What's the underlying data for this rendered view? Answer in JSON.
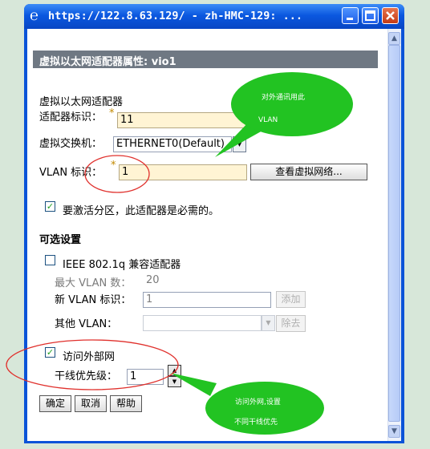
{
  "window": {
    "title": "https://122.8.63.129/ - zh-HMC-129: ...",
    "title_icon": "ie-icon",
    "controls": [
      "minimize-icon",
      "maximize-icon",
      "close-icon"
    ]
  },
  "panel": {
    "title": "虚拟以太网适配器属性: vio1"
  },
  "form": {
    "section_label": "虚拟以太网适配器",
    "adapter_id_label": "适配器标识：",
    "adapter_id_value": "11",
    "required_mark": "*",
    "vswitch_label": "虚拟交换机：",
    "vswitch_value": "ETHERNET0(Default)",
    "vlan_label": "VLAN 标识：",
    "vlan_value": "1",
    "view_networks_button": "查看虚拟网络...",
    "activate_checkbox_label": "要激活分区，此适配器是必需的。",
    "activate_checked": true
  },
  "optional": {
    "heading": "可选设置",
    "ieee_label": "IEEE 802.1q 兼容适配器",
    "ieee_checked": false,
    "max_vlan_label": "最大 VLAN 数：",
    "max_vlan_value": "20",
    "new_vlan_label": "新 VLAN 标识：",
    "new_vlan_placeholder": "1",
    "add_button": "添加",
    "other_vlan_label": "其他 VLAN：",
    "remove_button": "除去",
    "external_label": "访问外部网",
    "external_checked": true,
    "trunk_label": "干线优先级：",
    "trunk_value": "1"
  },
  "buttons": {
    "ok": "确定",
    "cancel": "取消",
    "help": "帮助"
  },
  "annotations": {
    "bubble1_line1": "对外通讯用此",
    "bubble1_line2": "VLAN",
    "bubble2_line1": "访问外网,设置",
    "bubble2_line2": "不同干线优先"
  },
  "colors": {
    "titlebar": "#0b58e0",
    "panel_header": "#6f7883",
    "required_field": "#fff4d4",
    "callout": "#22c322",
    "highlight_ellipse": "#e0302c"
  }
}
